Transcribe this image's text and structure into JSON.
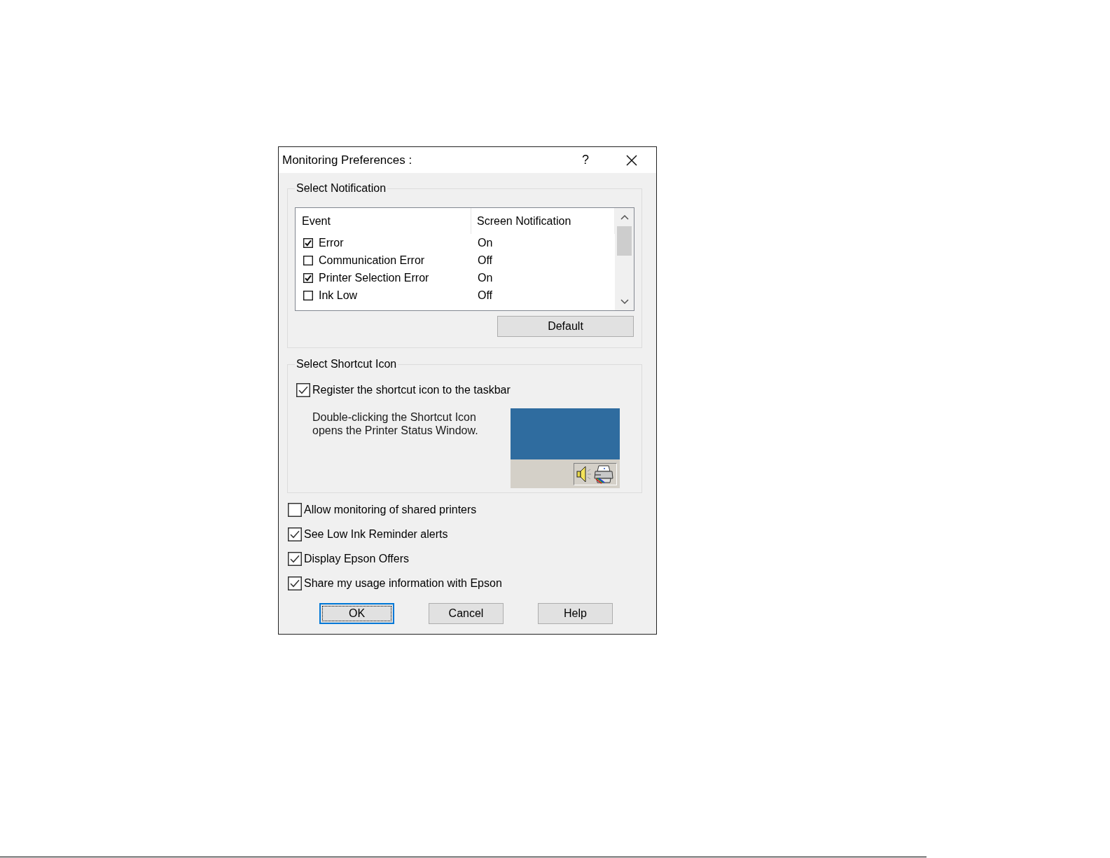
{
  "window": {
    "title": "Monitoring Preferences :",
    "help_glyph": "?"
  },
  "select_notification": {
    "legend": "Select Notification",
    "columns": [
      "Event",
      "Screen Notification"
    ],
    "rows": [
      {
        "event": "Error",
        "checked": true,
        "screen_notification": "On"
      },
      {
        "event": "Communication Error",
        "checked": false,
        "screen_notification": "Off"
      },
      {
        "event": "Printer Selection Error",
        "checked": true,
        "screen_notification": "On"
      },
      {
        "event": "Ink Low",
        "checked": false,
        "screen_notification": "Off"
      }
    ],
    "default_button": "Default"
  },
  "select_shortcut_icon": {
    "legend": "Select Shortcut Icon",
    "register_shortcut": {
      "label": "Register the shortcut icon to the taskbar",
      "checked": true
    },
    "description": "Double-clicking the Shortcut Icon opens the Printer Status Window."
  },
  "options": [
    {
      "label": "Allow monitoring of shared printers",
      "checked": false
    },
    {
      "label": "See Low Ink Reminder alerts",
      "checked": true
    },
    {
      "label": "Display Epson Offers",
      "checked": true
    },
    {
      "label": "Share my usage information with Epson",
      "checked": true
    }
  ],
  "buttons": [
    {
      "label": "OK",
      "focused": true
    },
    {
      "label": "Cancel",
      "focused": false
    },
    {
      "label": "Help",
      "focused": false
    }
  ]
}
